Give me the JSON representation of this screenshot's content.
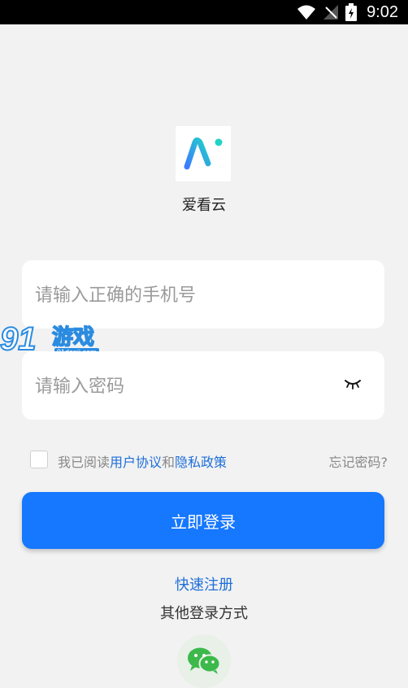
{
  "status_bar": {
    "time": "9:02"
  },
  "app": {
    "name": "爱看云"
  },
  "phone_field": {
    "placeholder": "请输入正确的手机号",
    "value": ""
  },
  "password_field": {
    "placeholder": "请输入密码",
    "value": ""
  },
  "agreement": {
    "prefix": "我已阅读",
    "user_agreement": "用户协议",
    "and": "和",
    "privacy_policy": "隐私政策",
    "checked": false
  },
  "forgot_password": "忘记密码?",
  "login_button": "立即登录",
  "quick_register": "快速注册",
  "other_login": "其他登录方式",
  "watermark": {
    "text": "游戏",
    "url": "91danji.com"
  },
  "colors": {
    "primary": "#1677ff",
    "link": "#1e6fd9",
    "background": "#f2f2f2"
  },
  "icons": [
    "wifi-icon",
    "signal-icon",
    "battery-icon",
    "app-logo",
    "eye-closed-icon",
    "wechat-icon"
  ]
}
